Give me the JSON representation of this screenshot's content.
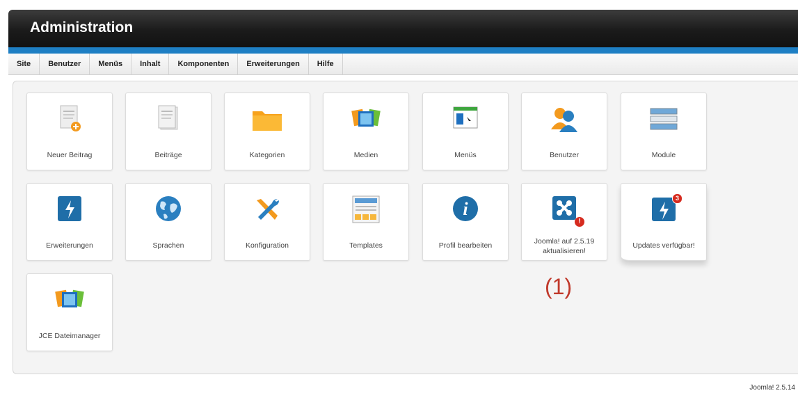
{
  "header": {
    "title": "Administration"
  },
  "menu": [
    "Site",
    "Benutzer",
    "Menüs",
    "Inhalt",
    "Komponenten",
    "Erweiterungen",
    "Hilfe"
  ],
  "tiles": [
    {
      "label": "Neuer Beitrag",
      "icon": "new-article-icon"
    },
    {
      "label": "Beiträge",
      "icon": "articles-icon"
    },
    {
      "label": "Kategorien",
      "icon": "folder-icon"
    },
    {
      "label": "Medien",
      "icon": "media-icon"
    },
    {
      "label": "Menüs",
      "icon": "menu-icon"
    },
    {
      "label": "Benutzer",
      "icon": "users-icon"
    },
    {
      "label": "Module",
      "icon": "modules-icon"
    },
    {
      "label": "Erweiterungen",
      "icon": "extensions-icon"
    },
    {
      "label": "Sprachen",
      "icon": "globe-icon"
    },
    {
      "label": "Konfiguration",
      "icon": "tools-icon"
    },
    {
      "label": "Templates",
      "icon": "templates-icon"
    },
    {
      "label": "Profil bearbeiten",
      "icon": "info-icon"
    },
    {
      "label": "Joomla! auf 2.5.19 aktualisieren!",
      "icon": "joomla-update-icon",
      "badge": "!"
    },
    {
      "label": "Updates verfügbar!",
      "icon": "extension-updates-icon",
      "badge": "3"
    },
    {
      "label": "JCE Dateimanager",
      "icon": "jce-filemanager-icon"
    }
  ],
  "annotation": "(1)",
  "footer": {
    "version": "Joomla! 2.5.14"
  },
  "colors": {
    "accent": "#1e7fc4",
    "header": "#1b1b1b",
    "annotation": "#c0392b",
    "badge": "#d62b1f"
  }
}
